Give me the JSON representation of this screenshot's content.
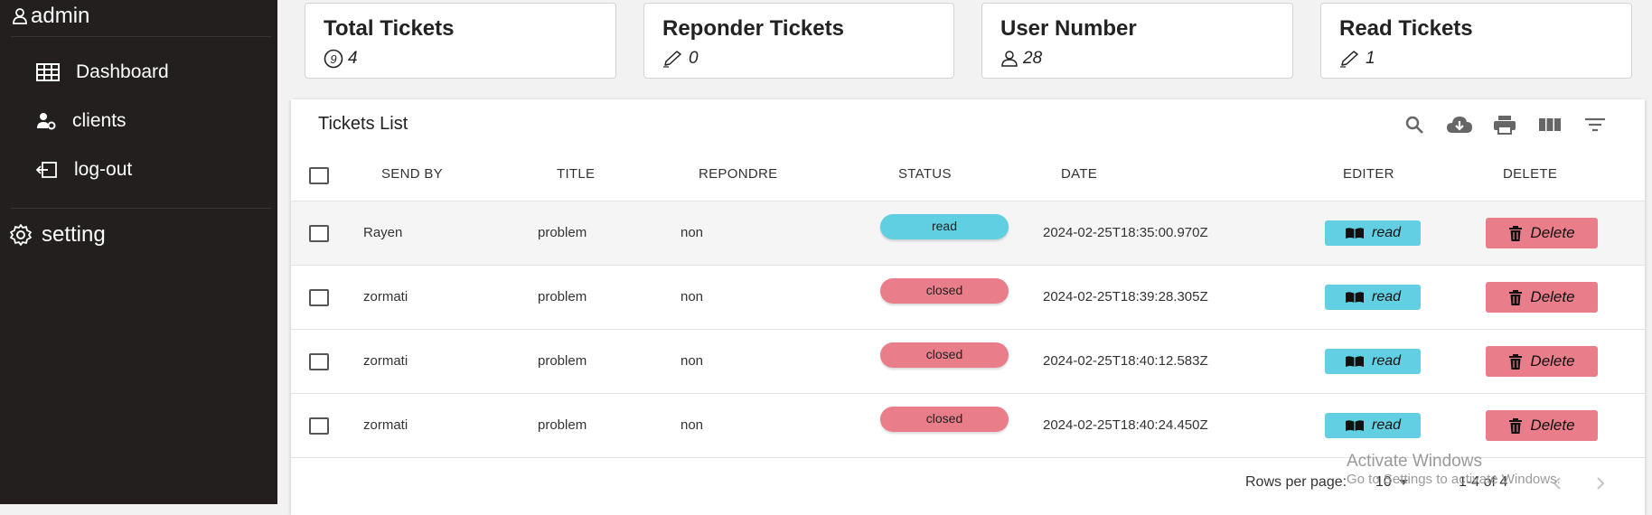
{
  "sidebar": {
    "user": "admin",
    "items": [
      {
        "label": "Dashboard",
        "icon": "table-icon"
      },
      {
        "label": "clients",
        "icon": "user-gear-icon"
      },
      {
        "label": "log-out",
        "icon": "logout-icon"
      }
    ],
    "setting": "setting"
  },
  "cards": [
    {
      "title": "Total Tickets",
      "value": "4",
      "icon": "nine-circle-icon"
    },
    {
      "title": "Reponder Tickets",
      "value": "0",
      "icon": "pencil-icon"
    },
    {
      "title": "User Number",
      "value": "28",
      "icon": "user-icon"
    },
    {
      "title": "Read Tickets",
      "value": "1",
      "icon": "pencil-icon"
    }
  ],
  "table": {
    "title": "Tickets List",
    "tools": [
      "search-icon",
      "download-icon",
      "print-icon",
      "columns-icon",
      "filter-icon"
    ],
    "columns": [
      "SEND BY",
      "TITLE",
      "REPONDRE",
      "STATUS",
      "DATE",
      "EDITER",
      "DELETE"
    ],
    "rows": [
      {
        "send_by": "Rayen",
        "title": "problem",
        "repondre": "non",
        "status": "read",
        "date": "2024-02-25T18:35:00.970Z",
        "edit": "read",
        "delete": "Delete"
      },
      {
        "send_by": "zormati",
        "title": "problem",
        "repondre": "non",
        "status": "closed",
        "date": "2024-02-25T18:39:28.305Z",
        "edit": "read",
        "delete": "Delete"
      },
      {
        "send_by": "zormati",
        "title": "problem",
        "repondre": "non",
        "status": "closed",
        "date": "2024-02-25T18:40:12.583Z",
        "edit": "read",
        "delete": "Delete"
      },
      {
        "send_by": "zormati",
        "title": "problem",
        "repondre": "non",
        "status": "closed",
        "date": "2024-02-25T18:40:24.450Z",
        "edit": "read",
        "delete": "Delete"
      }
    ],
    "footer": {
      "rows_per_page_label": "Rows per page:",
      "rows_per_page": "10",
      "range": "1-4 of 4"
    }
  },
  "watermark": {
    "line1": "Activate Windows",
    "line2": "Go to Settings to activate Windows."
  },
  "colors": {
    "sidebar": "#231f1e",
    "status_read": "#5fcfe1",
    "status_closed": "#e97d89",
    "read_button": "#62d0e2",
    "delete_button": "#e97d89"
  }
}
